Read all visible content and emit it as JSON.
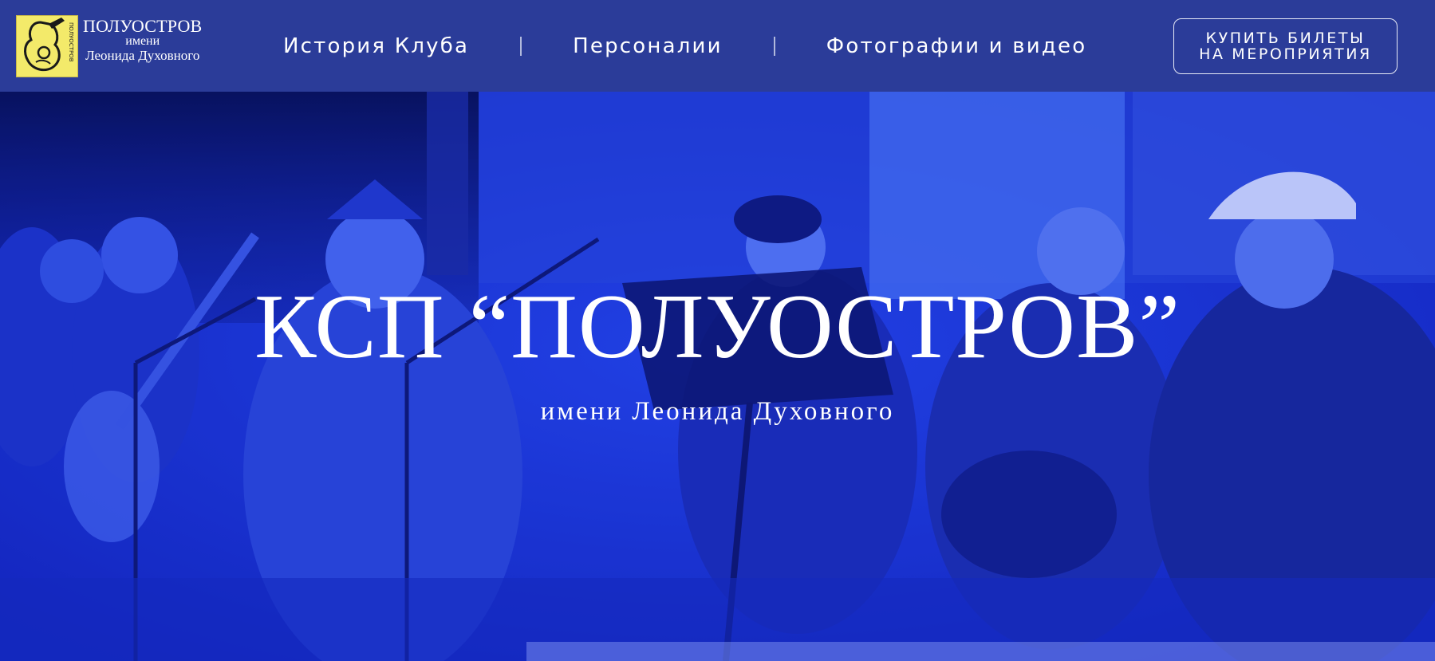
{
  "header": {
    "logo": {
      "line1": "ПОЛУОСТРОВ",
      "line2": "имени",
      "line3": "Леонида Духовного",
      "mark_text": "ПОЛУОСТРОВ"
    },
    "nav": [
      {
        "label": "История Клуба"
      },
      {
        "label": "Персоналии"
      },
      {
        "label": "Фотографии и видео"
      }
    ],
    "cta": {
      "line1": "КУПИТЬ БИЛЕТЫ",
      "line2": "НА МЕРОПРИЯТИЯ"
    }
  },
  "hero": {
    "title": "КСП “ПОЛУОСТРОВ”",
    "subtitle": "имени Леонида Духовного"
  },
  "colors": {
    "header_bg": "#2b3c99",
    "hero_tint": "#1a2fd0",
    "text": "#ffffff",
    "logo_bg": "#f3ea6a"
  }
}
